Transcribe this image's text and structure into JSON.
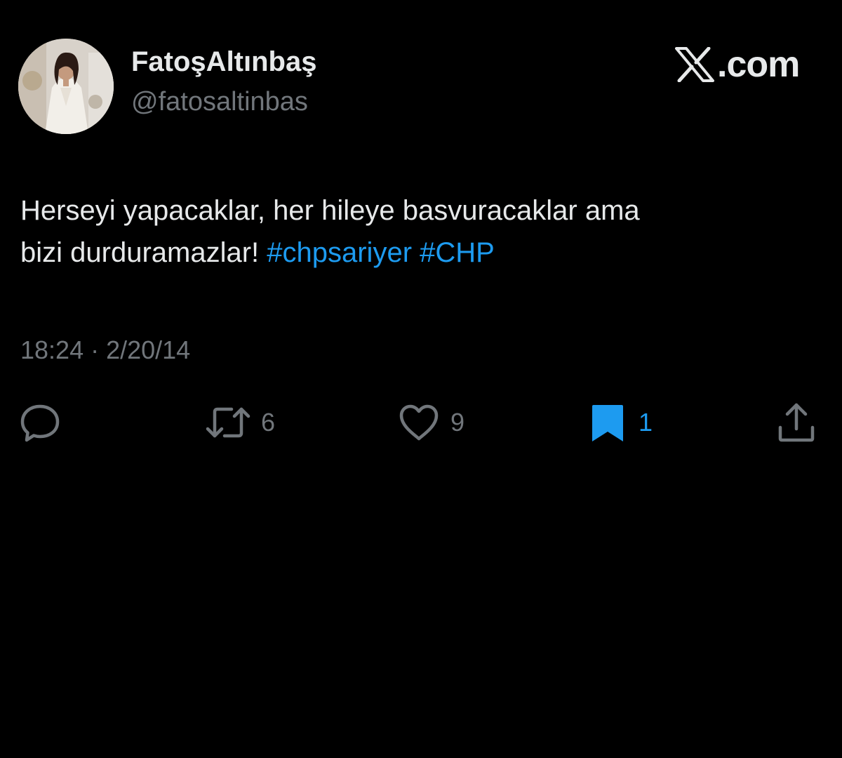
{
  "author": {
    "display_name": "FatoşAltınbaş",
    "handle": "@fatosaltinbas",
    "avatar_icon": "profile-photo"
  },
  "brand": {
    "icon": "x-logo-icon",
    "text": ".com"
  },
  "tweet": {
    "line1": "Herseyi yapacaklar, her hileye basvuracaklar ama",
    "line2_text": "bizi durduramazlar! ",
    "hashtag1": "#chpsariyer",
    "hashtag2": "#CHP",
    "hashtag_color": "#1d9bf0"
  },
  "meta": {
    "time": "18:24",
    "separator": " · ",
    "date": "2/20/14"
  },
  "actions": {
    "reply_icon": "reply-icon",
    "retweet_icon": "retweet-icon",
    "retweet_count": "6",
    "like_icon": "heart-icon",
    "like_count": "9",
    "bookmark_icon": "bookmark-icon",
    "bookmark_count": "1",
    "bookmark_color": "#1d9bf0",
    "share_icon": "share-icon"
  },
  "colors": {
    "background": "#000000",
    "text": "#e7e9ea",
    "secondary": "#71767b"
  }
}
